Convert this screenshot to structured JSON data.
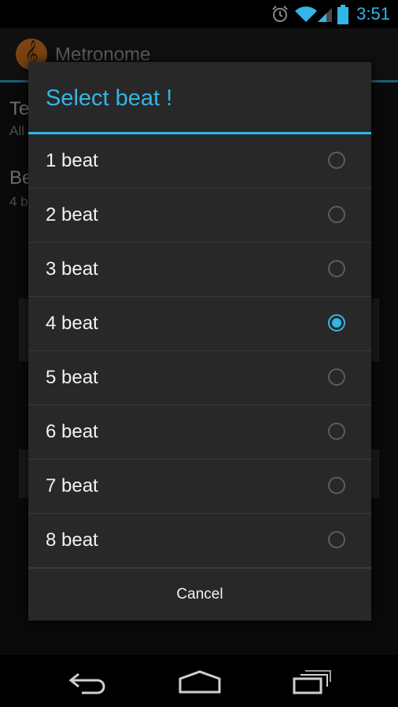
{
  "status_bar": {
    "time": "3:51",
    "icons": [
      "alarm-icon",
      "wifi-icon",
      "signal-icon",
      "battery-icon"
    ],
    "accent": "#33b5e5"
  },
  "app": {
    "title": "Metronome"
  },
  "background": {
    "items": [
      {
        "title": "Te",
        "subtitle": "All"
      },
      {
        "title": "Be",
        "subtitle": "4 b"
      }
    ]
  },
  "dialog": {
    "title": "Select beat !",
    "options": [
      {
        "label": "1 beat",
        "checked": false
      },
      {
        "label": "2 beat",
        "checked": false
      },
      {
        "label": "3 beat",
        "checked": false
      },
      {
        "label": "4 beat",
        "checked": true
      },
      {
        "label": "5 beat",
        "checked": false
      },
      {
        "label": "6 beat",
        "checked": false
      },
      {
        "label": "7 beat",
        "checked": false
      },
      {
        "label": "8 beat",
        "checked": false
      }
    ],
    "cancel_label": "Cancel"
  },
  "nav_bar": {
    "buttons": [
      "back-icon",
      "home-icon",
      "recent-apps-icon"
    ]
  },
  "colors": {
    "accent": "#33b5e5",
    "dialog_bg": "#282828",
    "text": "#f2f2f2"
  }
}
